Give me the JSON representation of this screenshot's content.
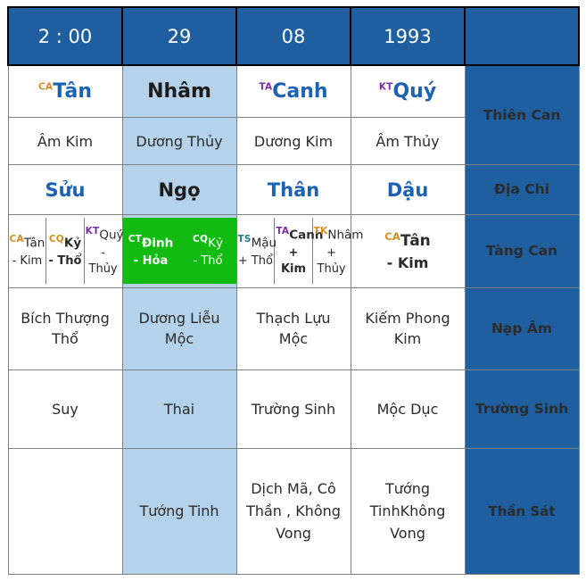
{
  "header": {
    "columns": [
      "2 : 00",
      "29",
      "08",
      "1993"
    ],
    "corner_label": ""
  },
  "row_labels": {
    "thien_can": "Thiên Can",
    "dia_chi": "Địa Chi",
    "tang_can": "Tàng Can",
    "nap_am": "Nạp Âm",
    "truong_sinh": "Trường Sinh",
    "than_sat": "Thần Sát"
  },
  "columns": [
    {
      "key": "hour",
      "highlight": false
    },
    {
      "key": "day",
      "highlight": true
    },
    {
      "key": "month",
      "highlight": false
    },
    {
      "key": "year",
      "highlight": false
    }
  ],
  "thien_can": [
    {
      "sup": "CA",
      "sup_kind": "ca",
      "name": "Tân"
    },
    {
      "sup": "",
      "sup_kind": "",
      "name": "Nhâm"
    },
    {
      "sup": "TA",
      "sup_kind": "ta",
      "name": "Canh"
    },
    {
      "sup": "KT",
      "sup_kind": "kt",
      "name": "Quý"
    }
  ],
  "thien_can_element": [
    "Âm Kim",
    "Dương Thủy",
    "Dương Kim",
    "Âm Thủy"
  ],
  "dia_chi": [
    "Sửu",
    "Ngọ",
    "Thân",
    "Dậu"
  ],
  "tang_can": [
    {
      "column": "hour",
      "items": [
        {
          "sup": "CA",
          "sup_kind": "ca",
          "name": "Tân",
          "element": "- Kim",
          "bold": false,
          "green": false
        },
        {
          "sup": "CQ",
          "sup_kind": "cq",
          "name": "Kỷ",
          "element": "- Thổ",
          "bold": true,
          "green": false
        },
        {
          "sup": "KT",
          "sup_kind": "kt",
          "name": "Quý",
          "element": "- Thủy",
          "bold": false,
          "green": false
        }
      ]
    },
    {
      "column": "day",
      "items": [
        {
          "sup": "CT",
          "sup_kind": "ct",
          "name": "Đinh",
          "element": "- Hỏa",
          "bold": true,
          "green": true
        },
        {
          "sup": "CQ",
          "sup_kind": "cq-g",
          "name": "Kỷ",
          "element": "- Thổ",
          "bold": false,
          "green": true
        }
      ]
    },
    {
      "column": "month",
      "items": [
        {
          "sup": "TS",
          "sup_kind": "ts",
          "name": "Mậu",
          "element": "+ Thổ",
          "bold": false,
          "green": false
        },
        {
          "sup": "TA",
          "sup_kind": "ta",
          "name": "Canh",
          "element": "+ Kim",
          "bold": true,
          "green": false
        },
        {
          "sup": "TK",
          "sup_kind": "tk",
          "name": "Nhâm",
          "element": "+ Thủy",
          "bold": false,
          "green": false
        }
      ]
    },
    {
      "column": "year",
      "items": [
        {
          "sup": "CA",
          "sup_kind": "ca",
          "name": "Tân",
          "element": "- Kim",
          "bold": true,
          "green": false
        }
      ]
    }
  ],
  "nap_am": [
    "Bích Thượng Thổ",
    "Dương Liễu Mộc",
    "Thạch Lựu Mộc",
    "Kiếm Phong Kim"
  ],
  "truong_sinh": [
    "Suy",
    "Thai",
    "Trường Sinh",
    "Mộc Dục"
  ],
  "than_sat": [
    "",
    "Tướng Tinh",
    "Dịch Mã, Cô Thần , Không Vong",
    "Tướng TinhKhông Vong"
  ],
  "colors": {
    "header_blue": "#1f5fa0",
    "highlight_blue": "#b4d2ea",
    "green": "#11bb11",
    "text_blue": "#1b62b5",
    "border_gray": "#7f7f7f",
    "border_black": "#000000",
    "sup_orange": "#d98c1b",
    "sup_purple": "#7b2ea8",
    "sup_teal": "#1a7f8e"
  }
}
